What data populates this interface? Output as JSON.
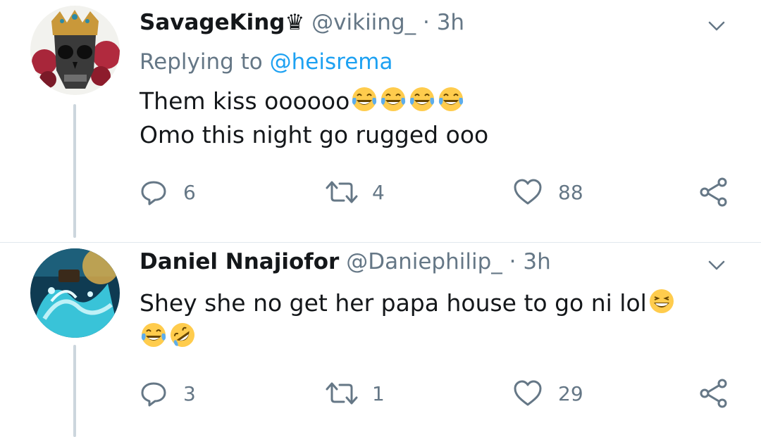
{
  "tweets": [
    {
      "name": "SavageKing♛",
      "handle": "@vikiing_",
      "separator": "·",
      "time": "3h",
      "replying_prefix": "Replying to",
      "replying_to": "@heisrema",
      "lines": [
        "Them kiss oooooo",
        "Omo this night go rugged ooo"
      ],
      "line1_emojis": [
        "tears-of-joy",
        "tears-of-joy",
        "tears-of-joy",
        "tears-of-joy"
      ],
      "replies": "6",
      "retweets": "4",
      "likes": "88"
    },
    {
      "name": "Daniel Nnajiofor",
      "handle": "@Daniephilip_",
      "separator": "·",
      "time": "3h",
      "lines": [
        "Shey she no get her papa house to go ni lol"
      ],
      "line1_emojis": [
        "grinning-squinting"
      ],
      "line2_emojis": [
        "tears-of-joy",
        "rolling-on-floor-laughing"
      ],
      "replies": "3",
      "retweets": "1",
      "likes": "29"
    }
  ],
  "colors": {
    "primary_text": "#14171a",
    "secondary_text": "#657786",
    "link": "#1da1f2",
    "thread_line": "#ccd6dd",
    "emoji_yellow": "#ffcc4d"
  }
}
